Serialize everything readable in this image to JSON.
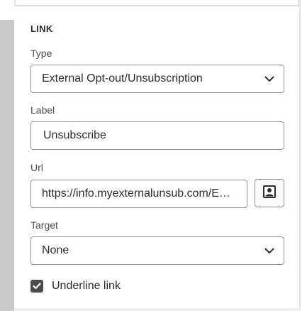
{
  "link_panel": {
    "section_title": "LINK",
    "type": {
      "label": "Type",
      "selected": "External Opt-out/Unsubscription",
      "chevron_icon": "chevron-down-icon"
    },
    "label_field": {
      "label": "Label",
      "value": "Unsubscribe"
    },
    "url": {
      "label": "Url",
      "value": "https://info.myexternalunsub.com/E…",
      "picker_icon": "asset-picker-icon"
    },
    "target": {
      "label": "Target",
      "selected": "None",
      "chevron_icon": "chevron-down-icon"
    },
    "underline": {
      "label": "Underline link",
      "checked": true,
      "check_icon": "checkmark-icon"
    }
  }
}
